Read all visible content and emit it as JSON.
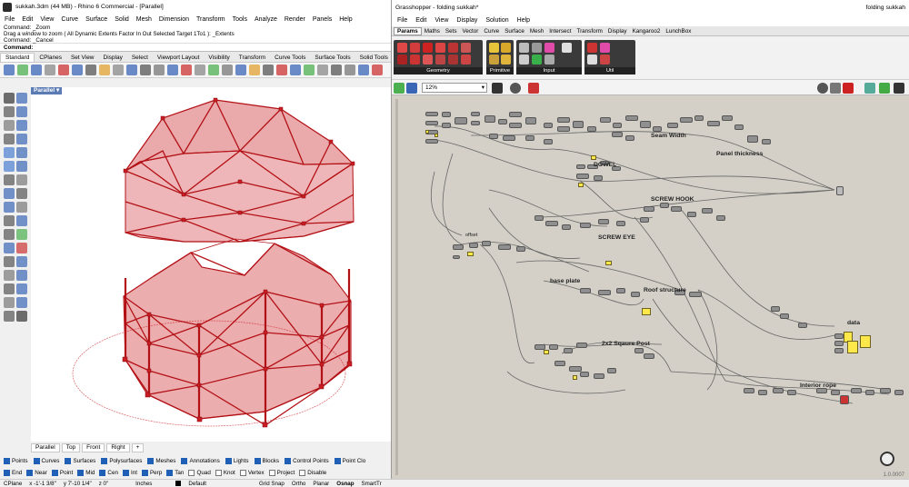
{
  "rhino": {
    "title": "sukkah.3dm (44 MB) - Rhino 6 Commercial - [Parallel]",
    "menu": [
      "File",
      "Edit",
      "View",
      "Curve",
      "Surface",
      "Solid",
      "Mesh",
      "Dimension",
      "Transform",
      "Tools",
      "Analyze",
      "Render",
      "Panels",
      "Help"
    ],
    "command_history": [
      "Command: _Zoom",
      "Drag a window to zoom ( All  Dynamic  Extents  Factor  In  Out  Selected  Target  1To1 ): _Extents",
      "Command: _Cancel"
    ],
    "command_prompt": "Command:",
    "toolbar_tabs": [
      "Standard",
      "CPlanes",
      "Set View",
      "Display",
      "Select",
      "Viewport Layout",
      "Visibility",
      "Transform",
      "Curve Tools",
      "Surface Tools",
      "Solid Tools"
    ],
    "active_tab": "Standard",
    "viewport_label": "Parallel",
    "viewport_tabs": [
      "Parallel",
      "Top",
      "Front",
      "Right",
      "+"
    ],
    "osnap_row1": [
      {
        "label": "Points",
        "on": true
      },
      {
        "label": "Curves",
        "on": true
      },
      {
        "label": "Surfaces",
        "on": true
      },
      {
        "label": "Polysurfaces",
        "on": true
      },
      {
        "label": "Meshes",
        "on": true
      },
      {
        "label": "Annotations",
        "on": true
      },
      {
        "label": "Lights",
        "on": true
      },
      {
        "label": "Blocks",
        "on": true
      },
      {
        "label": "Control Points",
        "on": true
      },
      {
        "label": "Point Clo",
        "on": true
      }
    ],
    "osnap_row2": [
      {
        "label": "End",
        "on": true
      },
      {
        "label": "Near",
        "on": true
      },
      {
        "label": "Point",
        "on": true
      },
      {
        "label": "Mid",
        "on": true
      },
      {
        "label": "Cen",
        "on": true
      },
      {
        "label": "Int",
        "on": true
      },
      {
        "label": "Perp",
        "on": true
      },
      {
        "label": "Tan",
        "on": true
      },
      {
        "label": "Quad",
        "on": false
      },
      {
        "label": "Knot",
        "on": false
      },
      {
        "label": "Vertex",
        "on": false
      },
      {
        "label": "Project",
        "on": false
      },
      {
        "label": "Disable",
        "on": false
      }
    ],
    "status": {
      "cplane": "CPlane",
      "x": "x -1'-1 3/8\"",
      "y": "y 7'-10 1/4\"",
      "z": "z 0\"",
      "units": "Inches",
      "layer": "Default",
      "toggles": [
        "Grid Snap",
        "Ortho",
        "Planar",
        "Osnap",
        "SmartTr"
      ]
    },
    "model_color": "#c91d22"
  },
  "grasshopper": {
    "title": "Grasshopper - folding sukkah*",
    "doc_name": "folding sukkah",
    "menu": [
      "File",
      "Edit",
      "View",
      "Display",
      "Solution",
      "Help"
    ],
    "tabs": [
      "Params",
      "Maths",
      "Sets",
      "Vector",
      "Curve",
      "Surface",
      "Mesh",
      "Intersect",
      "Transform",
      "Display",
      "Kangaroo2",
      "LunchBox"
    ],
    "active_tab": "Params",
    "ribbon_groups": [
      "Geometry",
      "Primitive",
      "Input",
      "Util"
    ],
    "zoom": "12%",
    "version": "1.0.0007",
    "group_labels": {
      "seam_width": "Seam Width",
      "panel_thickness": "Panel thickness",
      "dowel": "DOWEL",
      "screw_hook": "SCREW HOOK",
      "screw_eye": "SCREW EYE",
      "offset": "offset",
      "base_plate": "base plate",
      "roof_structure": "Roof structure",
      "post": "2x2 Sqaure Post",
      "data": "data",
      "interior_rope": "Interior rope"
    }
  }
}
